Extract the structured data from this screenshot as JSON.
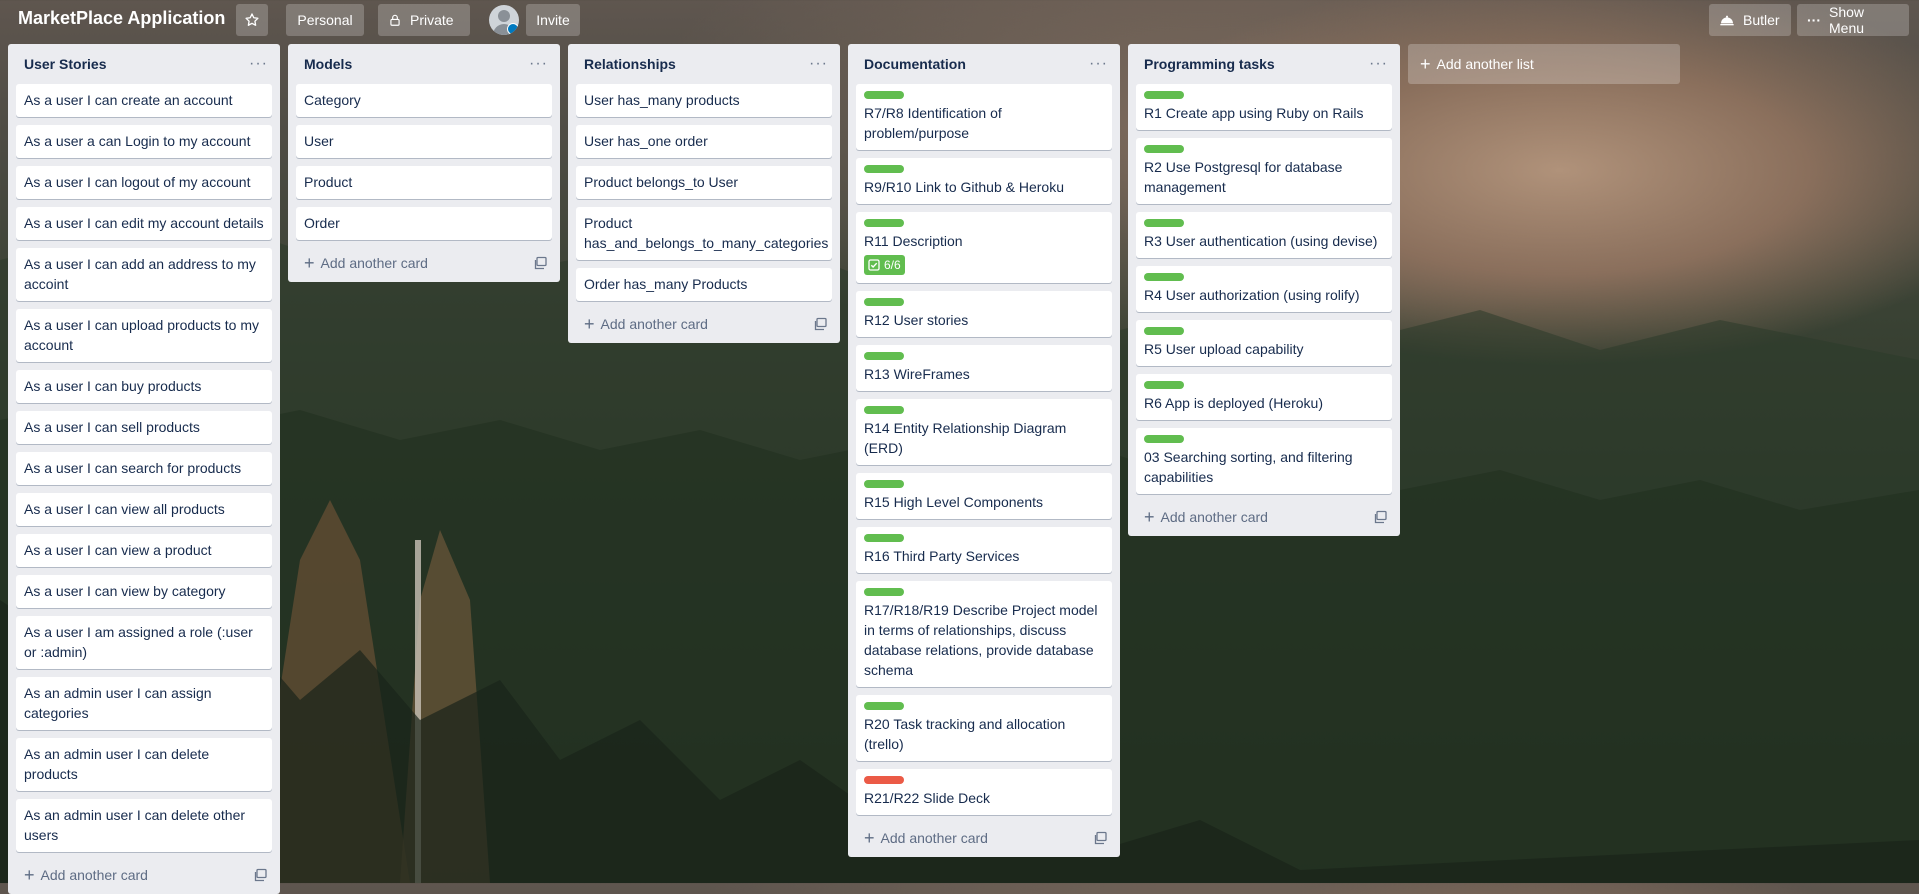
{
  "header": {
    "board_title": "MarketPlace Application",
    "personal": "Personal",
    "private": "Private",
    "invite": "Invite",
    "butler": "Butler",
    "show_menu": "Show Menu"
  },
  "add_card_label": "Add another card",
  "add_list_label": "Add another list",
  "colors": {
    "green": "#61bd4f",
    "red": "#eb5a46"
  },
  "lists": [
    {
      "title": "User Stories",
      "cards": [
        {
          "text": "As a user I can create an account"
        },
        {
          "text": "As a user a can Login to my account"
        },
        {
          "text": "As a user I can logout of my account"
        },
        {
          "text": "As a user I can edit my account details"
        },
        {
          "text": "As a user I can add an address to my accoint"
        },
        {
          "text": "As a user I can upload products to my account"
        },
        {
          "text": "As a user I can buy products"
        },
        {
          "text": "As a user I can sell products"
        },
        {
          "text": "As a user I can search for products"
        },
        {
          "text": "As a user I can view all products"
        },
        {
          "text": "As a user I can view a product"
        },
        {
          "text": "As a user I can view by category"
        },
        {
          "text": "As a user I am assigned a role (:user or :admin)"
        },
        {
          "text": "As an admin user I can assign categories"
        },
        {
          "text": "As an admin user I can delete products"
        },
        {
          "text": "As an admin user I can delete other users"
        }
      ]
    },
    {
      "title": "Models",
      "cards": [
        {
          "text": "Category"
        },
        {
          "text": "User"
        },
        {
          "text": "Product"
        },
        {
          "text": "Order"
        }
      ]
    },
    {
      "title": "Relationships",
      "cards": [
        {
          "text": "User has_many products"
        },
        {
          "text": "User has_one order"
        },
        {
          "text": "Product belongs_to User"
        },
        {
          "text": "Product has_and_belongs_to_many_categories"
        },
        {
          "text": "Order has_many Products"
        }
      ]
    },
    {
      "title": "Documentation",
      "cards": [
        {
          "text": "R7/R8 Identification of problem/purpose",
          "label": "green"
        },
        {
          "text": "R9/R10 Link to Github & Heroku",
          "label": "green"
        },
        {
          "text": "R11 Description",
          "label": "green",
          "checklist": "6/6"
        },
        {
          "text": "R12 User stories",
          "label": "green"
        },
        {
          "text": "R13 WireFrames",
          "label": "green"
        },
        {
          "text": "R14 Entity Relationship Diagram (ERD)",
          "label": "green"
        },
        {
          "text": "R15 High Level Components",
          "label": "green"
        },
        {
          "text": "R16 Third Party Services",
          "label": "green"
        },
        {
          "text": "R17/R18/R19 Describe Project model in terms of relationships, discuss database relations, provide database schema",
          "label": "green"
        },
        {
          "text": "R20 Task tracking and allocation (trello)",
          "label": "green"
        },
        {
          "text": "R21/R22 Slide Deck",
          "label": "red"
        }
      ]
    },
    {
      "title": "Programming tasks",
      "cards": [
        {
          "text": "R1 Create app using Ruby on Rails",
          "label": "green"
        },
        {
          "text": "R2 Use Postgresql for database management",
          "label": "green"
        },
        {
          "text": "R3 User authentication (using devise)",
          "label": "green"
        },
        {
          "text": "R4 User authorization (using rolify)",
          "label": "green"
        },
        {
          "text": "R5 User upload capability",
          "label": "green"
        },
        {
          "text": "R6 App is deployed (Heroku)",
          "label": "green"
        },
        {
          "text": "03 Searching sorting, and filtering capabilities",
          "label": "green"
        }
      ]
    }
  ]
}
